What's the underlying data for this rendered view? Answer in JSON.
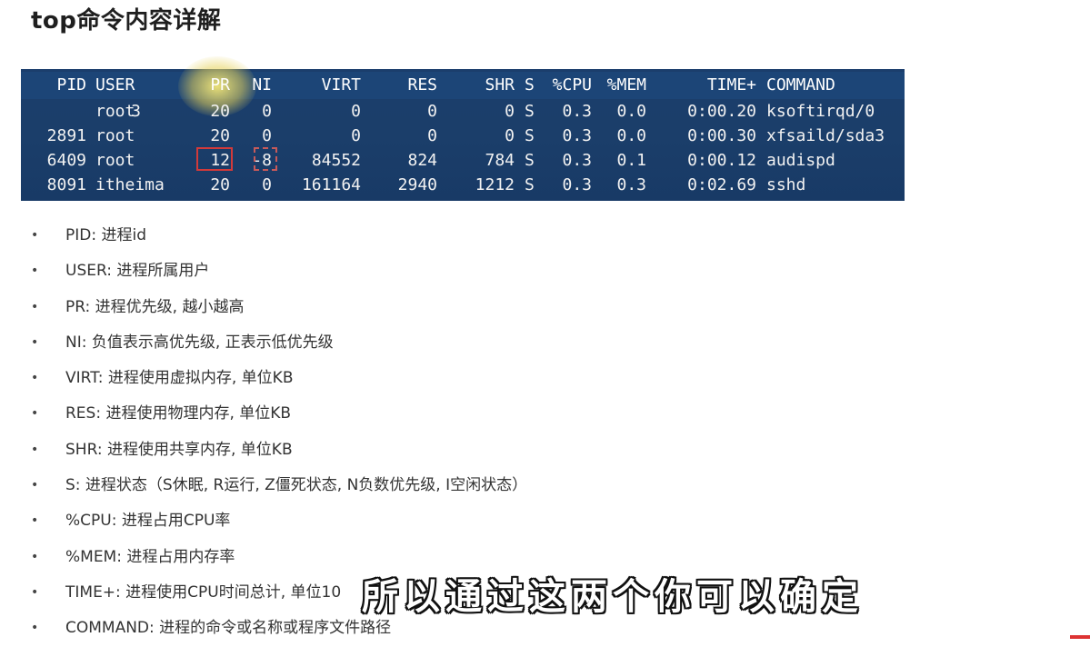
{
  "title": "top命令内容详解",
  "terminal": {
    "header": [
      "PID",
      "USER",
      "PR",
      "NI",
      "VIRT",
      "RES",
      "SHR",
      "S",
      "%CPU",
      "%MEM",
      "TIME+",
      "COMMAND"
    ],
    "rows": [
      [
        "3",
        "root",
        "20",
        "0",
        "0",
        "0",
        "0",
        "S",
        "0.3",
        "0.0",
        "0:00.20",
        "ksoftirqd/0"
      ],
      [
        "2891",
        "root",
        "20",
        "0",
        "0",
        "0",
        "0",
        "S",
        "0.3",
        "0.0",
        "0:00.30",
        "xfsaild/sda3"
      ],
      [
        "6409",
        "root",
        "12",
        "-8",
        "84552",
        "824",
        "784",
        "S",
        "0.3",
        "0.1",
        "0:00.12",
        "audispd"
      ],
      [
        "8091",
        "itheima",
        "20",
        "0",
        "161164",
        "2940",
        "1212",
        "S",
        "0.3",
        "0.3",
        "0:02.69",
        "sshd"
      ]
    ]
  },
  "definitions": [
    "PID: 进程id",
    "USER: 进程所属用户",
    "PR: 进程优先级, 越小越高",
    "NI: 负值表示高优先级, 正表示低优先级",
    "VIRT: 进程使用虚拟内存, 单位KB",
    "RES: 进程使用物理内存, 单位KB",
    "SHR: 进程使用共享内存, 单位KB",
    "S: 进程状态（S休眠, R运行, Z僵死状态, N负数优先级, I空闲状态）",
    "%CPU: 进程占用CPU率",
    "%MEM: 进程占用内存率",
    "TIME+: 进程使用CPU时间总计, 单位10",
    "COMMAND: 进程的命令或名称或程序文件路径"
  ],
  "bullet": "•",
  "subtitle": "所以通过这两个你可以确定",
  "colors": {
    "terminal_bg": "#1b3e6c",
    "header_bg": "#1c4577",
    "highlight_box": "#d23a3a"
  }
}
